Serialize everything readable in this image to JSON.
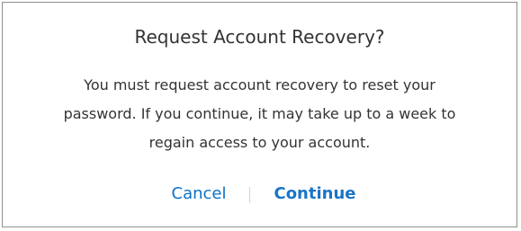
{
  "dialog": {
    "title": "Request Account Recovery?",
    "message_lines": [
      "You must request account recovery to reset your",
      "password. If you continue, it may take up to a week to",
      "regain access to your account."
    ],
    "buttons": {
      "cancel_label": "Cancel",
      "continue_label": "Continue"
    }
  },
  "colors": {
    "accent": "#0b72c9",
    "text": "#333333",
    "border": "#8f8f8f",
    "divider": "#d4d4d4"
  }
}
